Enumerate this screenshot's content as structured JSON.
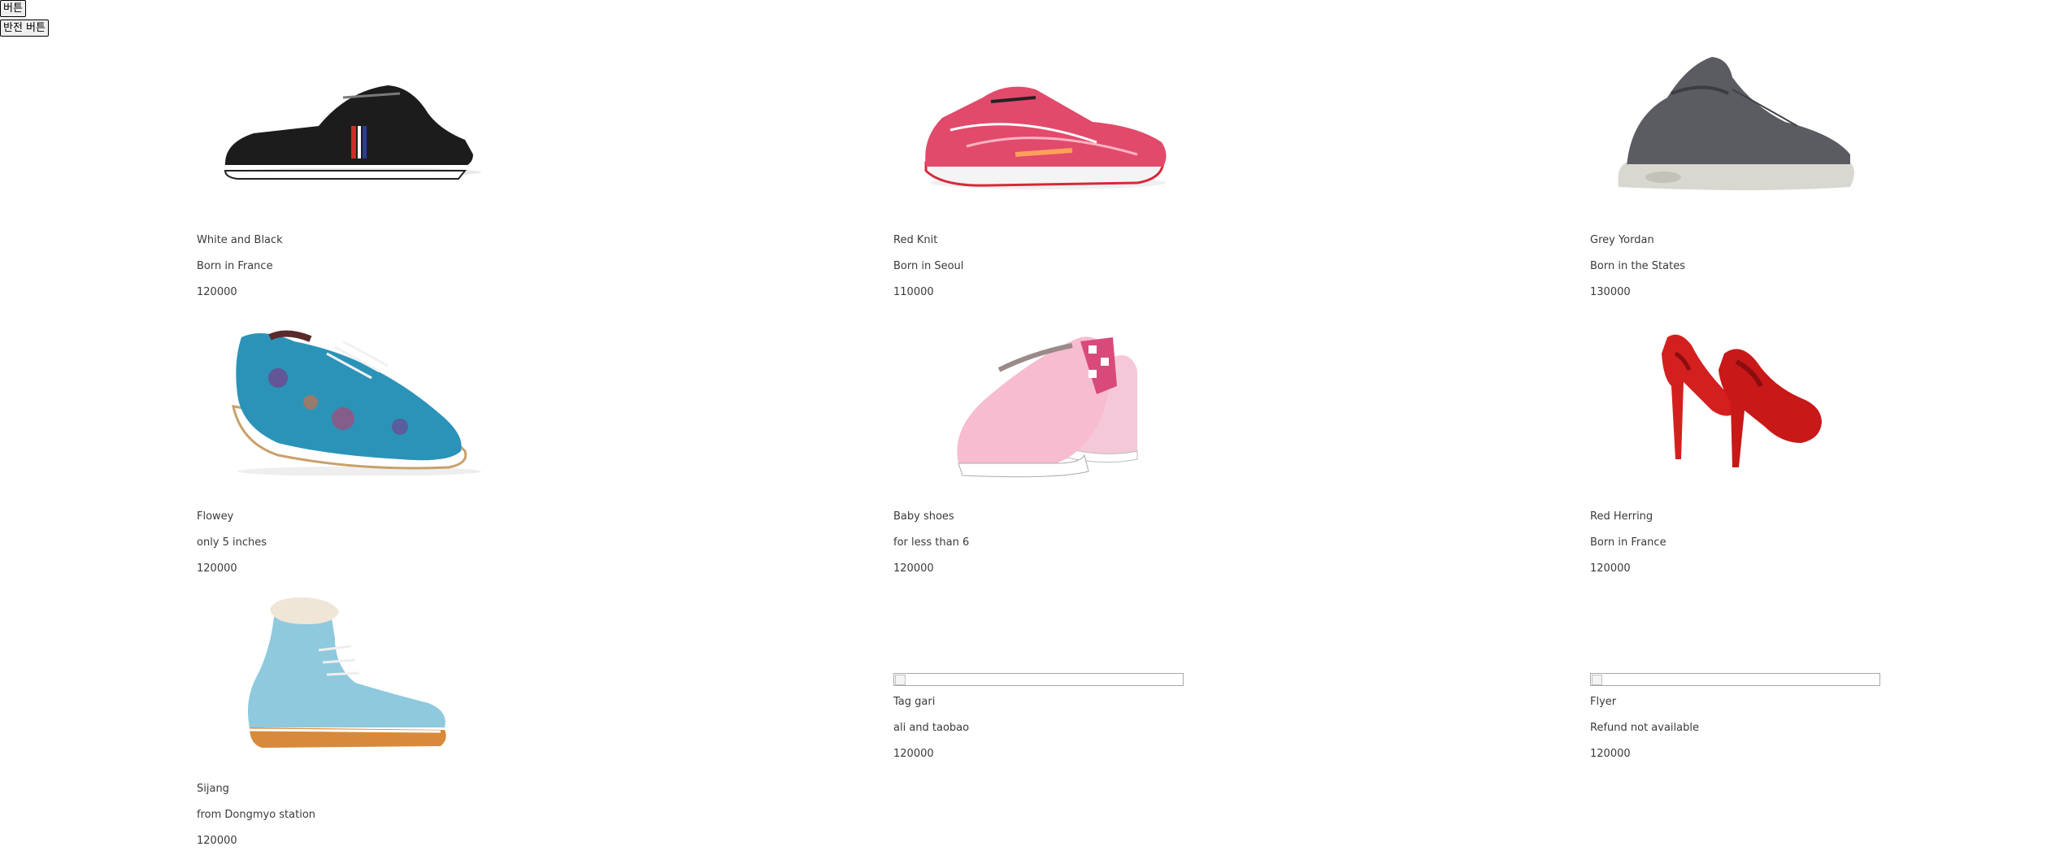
{
  "buttons": {
    "first_label": "버튼",
    "second_label": "반전 버튼"
  },
  "products": [
    {
      "name": "White and Black",
      "origin": "Born in France",
      "price": "120000",
      "image": "black-white-sneaker",
      "image_loaded": true
    },
    {
      "name": "Red Knit",
      "origin": "Born in Seoul",
      "price": "110000",
      "image": "pink-running-shoe",
      "image_loaded": true
    },
    {
      "name": "Grey Yordan",
      "origin": "Born in the States",
      "price": "130000",
      "image": "grey-high-top-sneaker",
      "image_loaded": true
    },
    {
      "name": "Flowey",
      "origin": "only 5 inches",
      "price": "120000",
      "image": "blue-floral-derby-shoe",
      "image_loaded": true
    },
    {
      "name": "Baby shoes",
      "origin": "for less than 6",
      "price": "120000",
      "image": "pink-slip-on-shoes",
      "image_loaded": true
    },
    {
      "name": "Red Herring",
      "origin": "Born in France",
      "price": "120000",
      "image": "red-suede-pumps",
      "image_loaded": true
    },
    {
      "name": "Sijang",
      "origin": "from Dongmyo station",
      "price": "120000",
      "image": "light-blue-boot",
      "image_loaded": true
    },
    {
      "name": "Tag gari",
      "origin": "ali and taobao",
      "price": "120000",
      "image": "broken-image",
      "image_loaded": false
    },
    {
      "name": "Flyer",
      "origin": "Refund not available",
      "price": "120000",
      "image": "broken-image",
      "image_loaded": false
    }
  ]
}
